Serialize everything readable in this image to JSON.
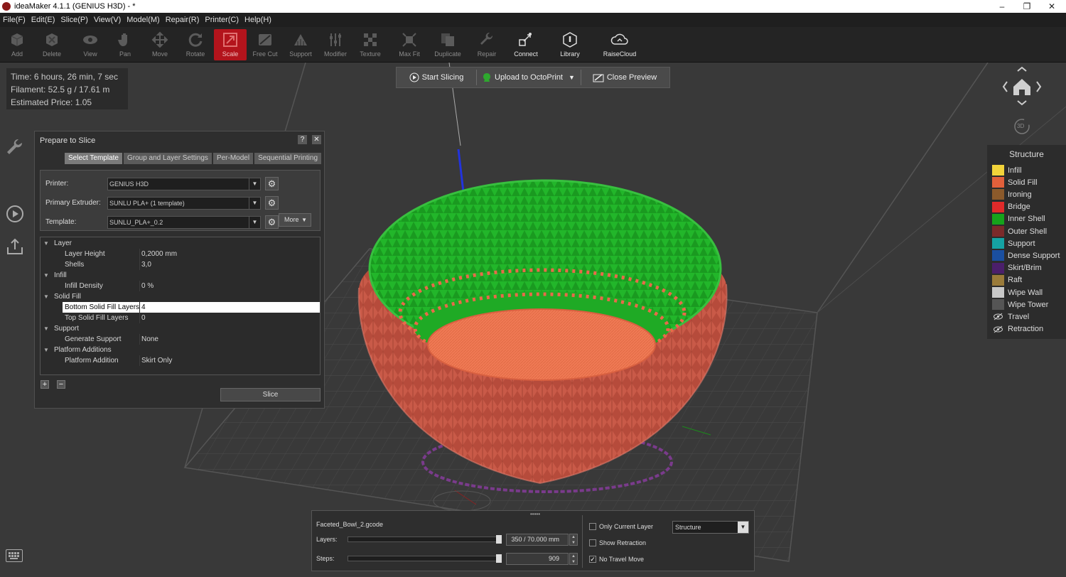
{
  "title": "ideaMaker 4.1.1 (GENIUS H3D) - *",
  "window_controls": [
    "–",
    "❐",
    "✕"
  ],
  "menu": [
    "File(F)",
    "Edit(E)",
    "Slice(P)",
    "View(V)",
    "Model(M)",
    "Repair(R)",
    "Printer(C)",
    "Help(H)"
  ],
  "toolbar": [
    "Add",
    "Delete",
    "View",
    "Pan",
    "Move",
    "Rotate",
    "Scale",
    "Free Cut",
    "Support",
    "Modifier",
    "Texture",
    "Max Fit",
    "Duplicate",
    "Repair",
    "Connect",
    "Library",
    "RaiseCloud"
  ],
  "info": {
    "time": "Time: 6 hours, 26 min, 7 sec",
    "filament": "Filament: 52.5 g / 17.61 m",
    "price": "Estimated Price: 1.05"
  },
  "slice_bar": {
    "start": "Start Slicing",
    "upload": "Upload to OctoPrint",
    "close": "Close Preview"
  },
  "prepare": {
    "title": "Prepare to Slice",
    "help": "?",
    "close": "✕",
    "tabs": [
      "Select Template",
      "Group and Layer Settings",
      "Per-Model",
      "Sequential Printing"
    ],
    "printer_label": "Printer:",
    "printer_value": "GENIUS H3D",
    "extruder_label": "Primary Extruder:",
    "extruder_value": "SUNLU PLA+ (1 template)",
    "template_label": "Template:",
    "template_value": "SUNLU_PLA+_0.2",
    "more": "More",
    "groups": {
      "layer": "Layer",
      "infill": "Infill",
      "solid_fill": "Solid Fill",
      "support": "Support",
      "platform": "Platform Additions"
    },
    "items": {
      "layer_height": {
        "k": "Layer Height",
        "v": "0,2000 mm"
      },
      "shells": {
        "k": "Shells",
        "v": "3,0"
      },
      "infill_density": {
        "k": "Infill Density",
        "v": "0 %"
      },
      "bottom_solid": {
        "k": "Bottom Solid Fill Layers",
        "v": "4"
      },
      "top_solid": {
        "k": "Top Solid Fill Layers",
        "v": "0"
      },
      "gen_support": {
        "k": "Generate Support",
        "v": "None"
      },
      "platform_addition": {
        "k": "Platform Addition",
        "v": "Skirt Only"
      }
    },
    "slice": "Slice"
  },
  "legend": {
    "title": "Structure",
    "items": [
      {
        "name": "Infill",
        "color": "#f2d33a"
      },
      {
        "name": "Solid Fill",
        "color": "#e2603b"
      },
      {
        "name": "Ironing",
        "color": "#8b5a2b"
      },
      {
        "name": "Bridge",
        "color": "#e02a2a"
      },
      {
        "name": "Inner Shell",
        "color": "#16a31b"
      },
      {
        "name": "Outer Shell",
        "color": "#7b2a2a"
      },
      {
        "name": "Support",
        "color": "#15a3a3"
      },
      {
        "name": "Dense Support",
        "color": "#1a4fa0"
      },
      {
        "name": "Skirt/Brim",
        "color": "#4b1f6b"
      },
      {
        "name": "Raft",
        "color": "#9a7b3a"
      },
      {
        "name": "Wipe Wall",
        "color": "#c8c8c8"
      },
      {
        "name": "Wipe Tower",
        "color": "#555555"
      },
      {
        "name": "Travel",
        "color": "eye-icon"
      },
      {
        "name": "Retraction",
        "color": "eye-icon"
      }
    ]
  },
  "bottom": {
    "file": "Faceted_Bowl_2.gcode",
    "layers_label": "Layers:",
    "layers_value": "350 / 70.000 mm",
    "steps_label": "Steps:",
    "steps_value": "909",
    "only_current": "Only Current Layer",
    "show_retraction": "Show Retraction",
    "no_travel": "No Travel Move",
    "view_mode": "Structure",
    "grip": "•••••"
  },
  "nav": {
    "label_3d": "3D"
  }
}
